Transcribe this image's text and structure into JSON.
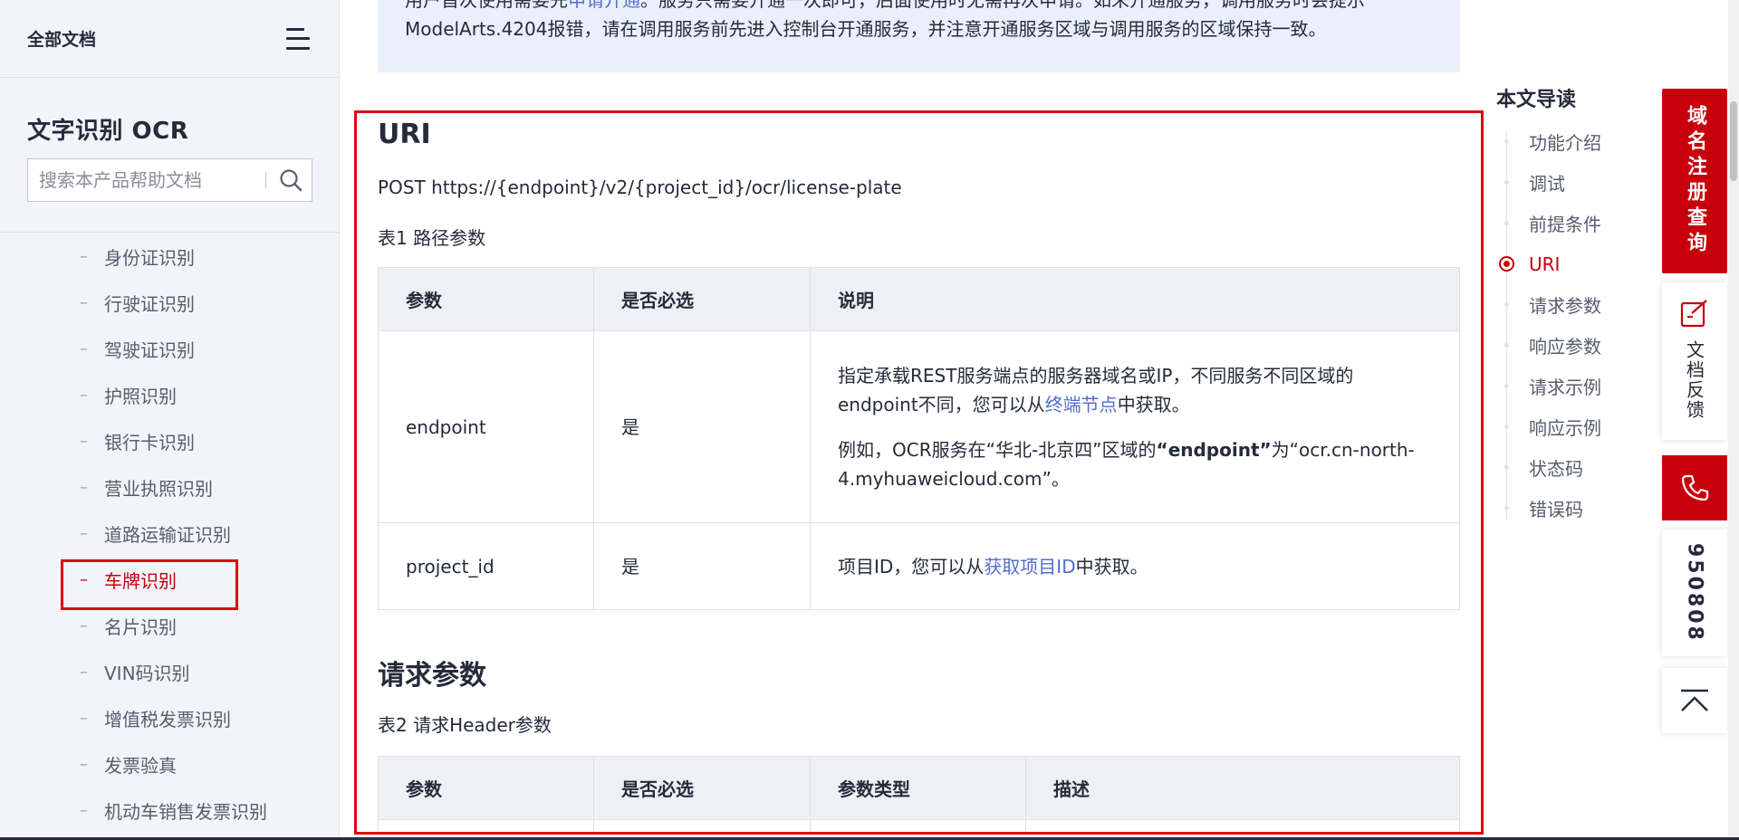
{
  "sidebar": {
    "all_docs": "全部文档",
    "product_title": "文字识别 OCR",
    "search_placeholder": "搜索本产品帮助文档",
    "items": [
      {
        "label": "身份证识别"
      },
      {
        "label": "行驶证识别"
      },
      {
        "label": "驾驶证识别"
      },
      {
        "label": "护照识别"
      },
      {
        "label": "银行卡识别"
      },
      {
        "label": "营业执照识别"
      },
      {
        "label": "道路运输证识别"
      },
      {
        "label": "车牌识别",
        "active": true
      },
      {
        "label": "名片识别"
      },
      {
        "label": "VIN码识别"
      },
      {
        "label": "增值税发票识别"
      },
      {
        "label": "发票验真"
      },
      {
        "label": "机动车销售发票识别"
      }
    ],
    "dash": "–"
  },
  "notice": {
    "line1_a": "用户首次使用需要先",
    "line1_link": "申请开通",
    "line1_b": "。服务只需要开通一次即可，后面使用时无需再次申请。如未开通服务，调用服务时会提示",
    "line2": "ModelArts.4204报错，请在调用服务前先进入控制台开通服务，并注意开通服务区域与调用服务的区域保持一致。"
  },
  "uri": {
    "heading": "URI",
    "endpoint_line": "POST https://{endpoint}/v2/{project_id}/ocr/license-plate",
    "table_caption": "表1 路径参数",
    "headers": [
      "参数",
      "是否必选",
      "说明"
    ],
    "rows": [
      {
        "param": "endpoint",
        "required": "是",
        "desc_a": "指定承载REST服务端点的服务器域名或IP，不同服务不同区域的endpoint不同，您可以从",
        "desc_link": "终端节点",
        "desc_b": "中获取。",
        "example_a": "例如，OCR服务在“华北-北京四”区域的",
        "example_bold": "“endpoint”",
        "example_b": "为“ocr.cn-north-4.myhuaweicloud.com”。"
      },
      {
        "param": "project_id",
        "required": "是",
        "desc_a": "项目ID，您可以从",
        "desc_link": "获取项目ID",
        "desc_b": "中获取。"
      }
    ]
  },
  "request": {
    "heading": "请求参数",
    "table_caption": "表2 请求Header参数",
    "headers": [
      "参数",
      "是否必选",
      "参数类型",
      "描述"
    ]
  },
  "toc": {
    "title": "本文导读",
    "items": [
      {
        "label": "功能介绍"
      },
      {
        "label": "调试"
      },
      {
        "label": "前提条件"
      },
      {
        "label": "URI",
        "active": true
      },
      {
        "label": "请求参数"
      },
      {
        "label": "响应参数"
      },
      {
        "label": "请求示例"
      },
      {
        "label": "响应示例"
      },
      {
        "label": "状态码"
      },
      {
        "label": "错误码"
      }
    ]
  },
  "rail": {
    "domain_query": "域名注册查询",
    "feedback": "文档反馈",
    "phone_number": "950808"
  },
  "colors": {
    "brand_red": "#c7000b",
    "link_blue": "#526ecc",
    "highlight_box": "#e0000d"
  },
  "icons": [
    "menu-icon",
    "search-icon",
    "edit-icon",
    "phone-icon",
    "back-to-top-icon"
  ]
}
